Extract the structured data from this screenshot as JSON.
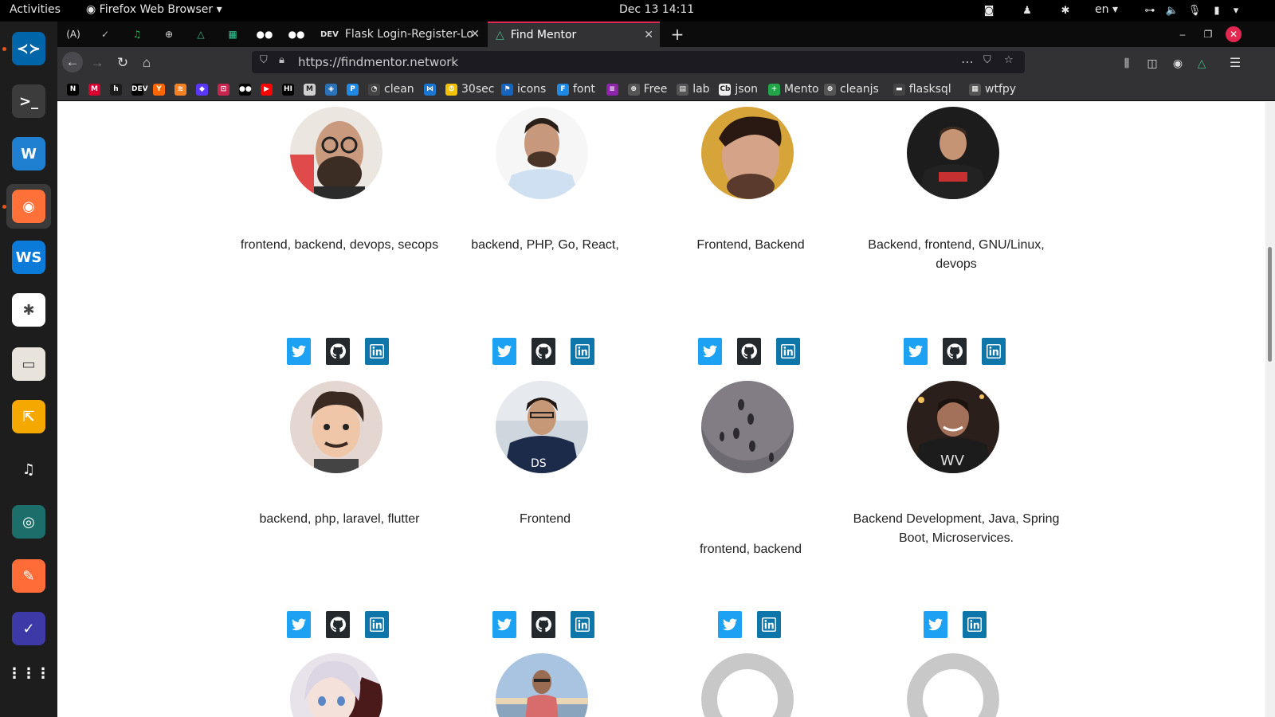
{
  "topbar": {
    "activities": "Activities",
    "app_menu": "Firefox Web Browser",
    "clock": "Dec 13  14:11",
    "language": "en"
  },
  "dock": {
    "items": [
      {
        "name": "vscode-icon",
        "bg": "#0065a9",
        "glyph": "≺≻"
      },
      {
        "name": "terminal-icon",
        "bg": "#3c3c3c",
        "glyph": ">_"
      },
      {
        "name": "monitor-app-icon",
        "bg": "#1f7fd1",
        "glyph": "W"
      },
      {
        "name": "firefox-icon",
        "bg": "#ff7139",
        "glyph": "◉"
      },
      {
        "name": "webstorm-icon",
        "bg": "#0a7bd8",
        "glyph": "WS"
      },
      {
        "name": "slack-icon",
        "bg": "#ffffff",
        "glyph": "✱"
      },
      {
        "name": "files-icon",
        "bg": "#e8e4dc",
        "glyph": "▭"
      },
      {
        "name": "arrows-app-icon",
        "bg": "#f5a800",
        "glyph": "⇱"
      },
      {
        "name": "music-icon",
        "bg": "#1d1d1d",
        "glyph": "♫"
      },
      {
        "name": "gitkraken-icon",
        "bg": "#1b6e6a",
        "glyph": "◎"
      },
      {
        "name": "postman-icon",
        "bg": "#ff6c37",
        "glyph": "✎"
      },
      {
        "name": "paint-app-icon",
        "bg": "#3d3aa8",
        "glyph": "✓"
      },
      {
        "name": "show-apps-icon",
        "bg": "#1d1d1d",
        "glyph": "⋮⋮⋮"
      }
    ]
  },
  "tabs": {
    "pinned": [
      "(A)",
      "✓",
      "♫",
      "⊕",
      "△",
      "▦",
      "●●",
      "●●"
    ],
    "tab1": {
      "label": "Flask Login-Register-Log",
      "favicon": "DEV"
    },
    "tab2": {
      "label": "Find Mentor"
    }
  },
  "navbar": {
    "url": "https://findmentor.network"
  },
  "bookmarks": [
    {
      "label": "",
      "fav": "N",
      "color": "#000000"
    },
    {
      "label": "",
      "fav": "M",
      "color": "#d6002f"
    },
    {
      "label": "",
      "fav": "h",
      "color": "#1c1c1c"
    },
    {
      "label": "",
      "fav": "DEV",
      "color": "#000000"
    },
    {
      "label": "",
      "fav": "Y",
      "color": "#ff6600"
    },
    {
      "label": "",
      "fav": "≋",
      "color": "#f48024"
    },
    {
      "label": "",
      "fav": "◆",
      "color": "#5b36ff"
    },
    {
      "label": "",
      "fav": "⊡",
      "color": "#c7254e"
    },
    {
      "label": "",
      "fav": "●●",
      "color": "#000000"
    },
    {
      "label": "",
      "fav": "▶",
      "color": "#ff0000"
    },
    {
      "label": "",
      "fav": "HI",
      "color": "#000000"
    },
    {
      "label": "",
      "fav": "M",
      "color": "#d0d0d0"
    },
    {
      "label": "",
      "fav": "◈",
      "color": "#2b73b8"
    },
    {
      "label": "",
      "fav": "P",
      "color": "#1e88e5"
    },
    {
      "label": "clean",
      "fav": "◔",
      "color": "#444444"
    },
    {
      "label": "",
      "fav": "⋈",
      "color": "#1976d2"
    },
    {
      "label": "30sec",
      "fav": "⏱",
      "color": "#f2c200"
    },
    {
      "label": "icons",
      "fav": "⚑",
      "color": "#1565c0"
    },
    {
      "label": "font",
      "fav": "F",
      "color": "#1e88e5"
    },
    {
      "label": "",
      "fav": "≡",
      "color": "#8e24aa"
    },
    {
      "label": "Free",
      "fav": "⊕",
      "color": "#555555"
    },
    {
      "label": "lab",
      "fav": "▤",
      "color": "#555555"
    },
    {
      "label": "json",
      "fav": "Cb",
      "color": "#eeeeee"
    },
    {
      "label": "Mento",
      "fav": "+",
      "color": "#22a44a"
    },
    {
      "label": "cleanjs",
      "fav": "⊕",
      "color": "#555555"
    },
    {
      "label": "flasksql",
      "fav": "▬",
      "color": "#444444"
    },
    {
      "label": "wtfpy",
      "fav": "▦",
      "color": "#555555"
    }
  ],
  "mentors_row1": [
    {
      "skills": "frontend, backend, devops, secops",
      "avatar": "glasses-beard",
      "social": [
        "twitter",
        "github",
        "linkedin"
      ]
    },
    {
      "skills": "backend, PHP, Go, React,",
      "avatar": "shirt-man",
      "social": [
        "twitter",
        "github",
        "linkedin"
      ]
    },
    {
      "skills": "Frontend, Backend",
      "avatar": "yellow-bg",
      "social": [
        "twitter",
        "github",
        "linkedin"
      ]
    },
    {
      "skills": "Backend, frontend, GNU/Linux, devops",
      "avatar": "dark-tee",
      "social": [
        "twitter",
        "github",
        "linkedin"
      ]
    }
  ],
  "mentors_row2": [
    {
      "skills": "backend, php, laravel, flutter",
      "avatar": "cartoon",
      "social": [
        "twitter",
        "github",
        "linkedin"
      ]
    },
    {
      "skills": "Frontend",
      "avatar": "hoodie",
      "social": [
        "twitter",
        "github",
        "linkedin"
      ]
    },
    {
      "skills": "frontend, backend",
      "avatar": "snow",
      "social": [
        "twitter",
        "linkedin"
      ]
    },
    {
      "skills": "Backend Development, Java, Spring Boot, Microservices.",
      "avatar": "smile-dark",
      "social": [
        "twitter",
        "linkedin"
      ]
    }
  ],
  "mentors_row3": [
    {
      "avatar": "anime"
    },
    {
      "avatar": "beach"
    },
    {
      "avatar": "placeholder"
    },
    {
      "avatar": "placeholder"
    }
  ],
  "colors": {
    "twitter": "#1da1f2",
    "github": "#24292e",
    "linkedin": "#0e76a8",
    "tab_accent": "#e22850"
  }
}
